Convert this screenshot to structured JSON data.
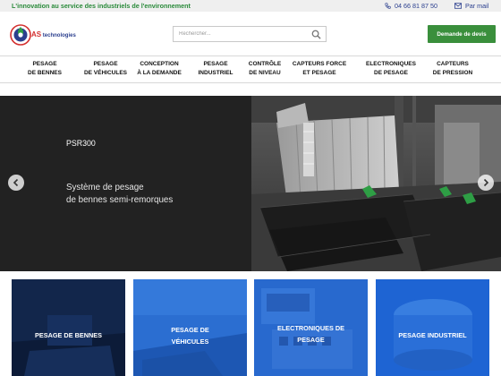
{
  "topbar": {
    "tagline": "L'innovation au service des industriels de l'environnement",
    "phone": "04 66 81 87 50",
    "mail": "Par mail",
    "phone_icon": "phone-icon",
    "mail_icon": "mail-icon"
  },
  "header": {
    "logo": {
      "as": "AS",
      "text": "technologies"
    },
    "search": {
      "placeholder": "Rechercher...",
      "value": "",
      "icon": "search-icon"
    },
    "quote_button": "Demande de devis"
  },
  "nav": {
    "items": [
      {
        "line1": "PESAGE",
        "line2": "DE BENNES"
      },
      {
        "line1": "PESAGE",
        "line2": "DE VÉHICULES"
      },
      {
        "line1": "CONCEPTION",
        "line2": "À LA DEMANDE"
      },
      {
        "line1": "PESAGE",
        "line2": "INDUSTRIEL"
      },
      {
        "line1": "CONTRÔLE",
        "line2": "DE NIVEAU"
      },
      {
        "line1": "CAPTEURS FORCE",
        "line2": "ET PESAGE"
      },
      {
        "line1": "ELECTRONIQUES",
        "line2": "DE PESAGE"
      },
      {
        "line1": "CAPTEURS",
        "line2": "DE PRESSION"
      }
    ]
  },
  "hero": {
    "title": "PSR300",
    "subtitle_line1": "Système de pesage",
    "subtitle_line2": "de bennes semi-remorques",
    "prev_icon": "arrow-left-icon",
    "next_icon": "arrow-right-icon"
  },
  "categories": [
    {
      "line1": "PESAGE DE BENNES",
      "line2": ""
    },
    {
      "line1": "PESAGE DE",
      "line2": "VÉHICULES"
    },
    {
      "line1": "ELECTRONIQUES DE",
      "line2": "PESAGE"
    },
    {
      "line1": "PESAGE INDUSTRIEL",
      "line2": ""
    }
  ],
  "colors": {
    "accent_green": "#3a8f3c",
    "tagline_green": "#2a8a3a",
    "brand_blue": "#2b3f8e",
    "card_blue": "#1f5fc9",
    "card_navy": "#0f1f3f"
  }
}
